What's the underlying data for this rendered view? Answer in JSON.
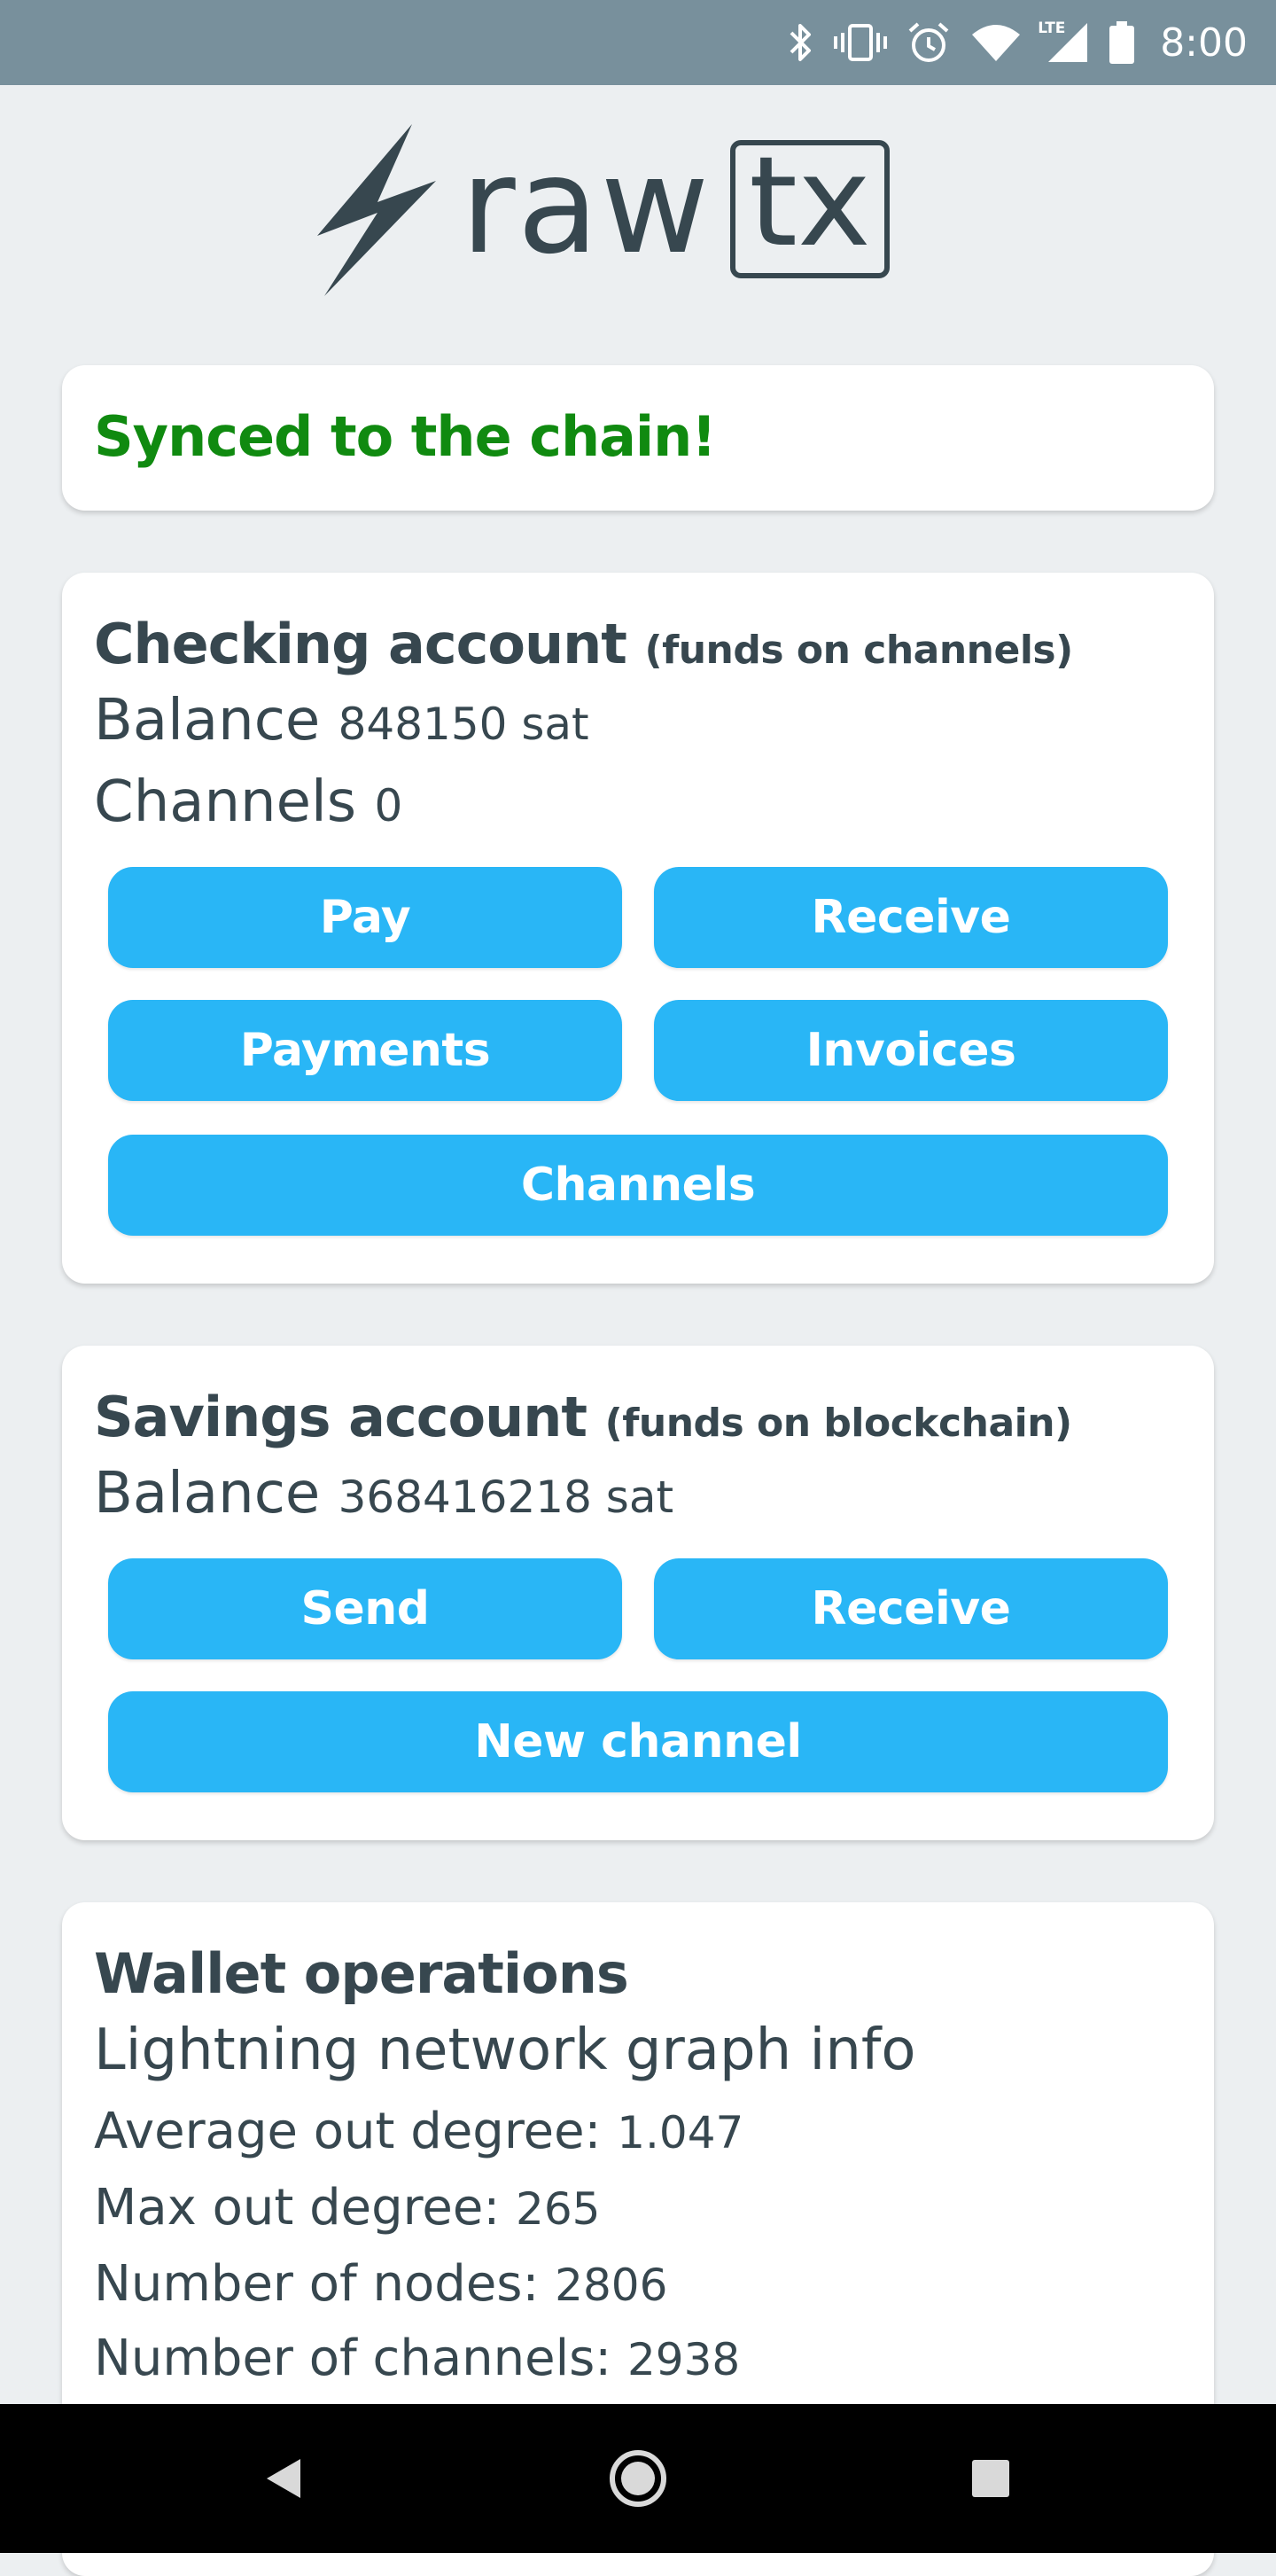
{
  "status_bar": {
    "time": "8:00",
    "network_label": "LTE",
    "icons": [
      "bluetooth-icon",
      "vibrate-icon",
      "alarm-icon",
      "wifi-icon",
      "cell-signal-icon",
      "battery-icon"
    ]
  },
  "logo": {
    "word": "raw",
    "boxed": "tx"
  },
  "sync": {
    "text": "Synced to the chain!",
    "color": "#108a10"
  },
  "checking": {
    "title": "Checking account",
    "subtitle": "(funds on channels)",
    "balance_label": "Balance",
    "balance_value": "848150 sat",
    "channels_label": "Channels",
    "channels_value": "0",
    "buttons": {
      "pay": "Pay",
      "receive": "Receive",
      "payments": "Payments",
      "invoices": "Invoices",
      "channels": "Channels"
    }
  },
  "savings": {
    "title": "Savings account",
    "subtitle": "(funds on blockchain)",
    "balance_label": "Balance",
    "balance_value": "368416218 sat",
    "buttons": {
      "send": "Send",
      "receive": "Receive",
      "new_channel": "New channel"
    }
  },
  "wallet": {
    "title": "Wallet operations",
    "graph_heading": "Lightning network graph info",
    "stats": [
      {
        "label": "Average out degree:",
        "value": "1.047"
      },
      {
        "label": "Max out degree:",
        "value": "265"
      },
      {
        "label": "Number of nodes:",
        "value": "2806"
      },
      {
        "label": "Number of channels:",
        "value": "2938"
      }
    ]
  },
  "colors": {
    "accent": "#29b6f6",
    "status_bar": "#78909c",
    "background": "#eceff1",
    "text": "#37474f"
  }
}
